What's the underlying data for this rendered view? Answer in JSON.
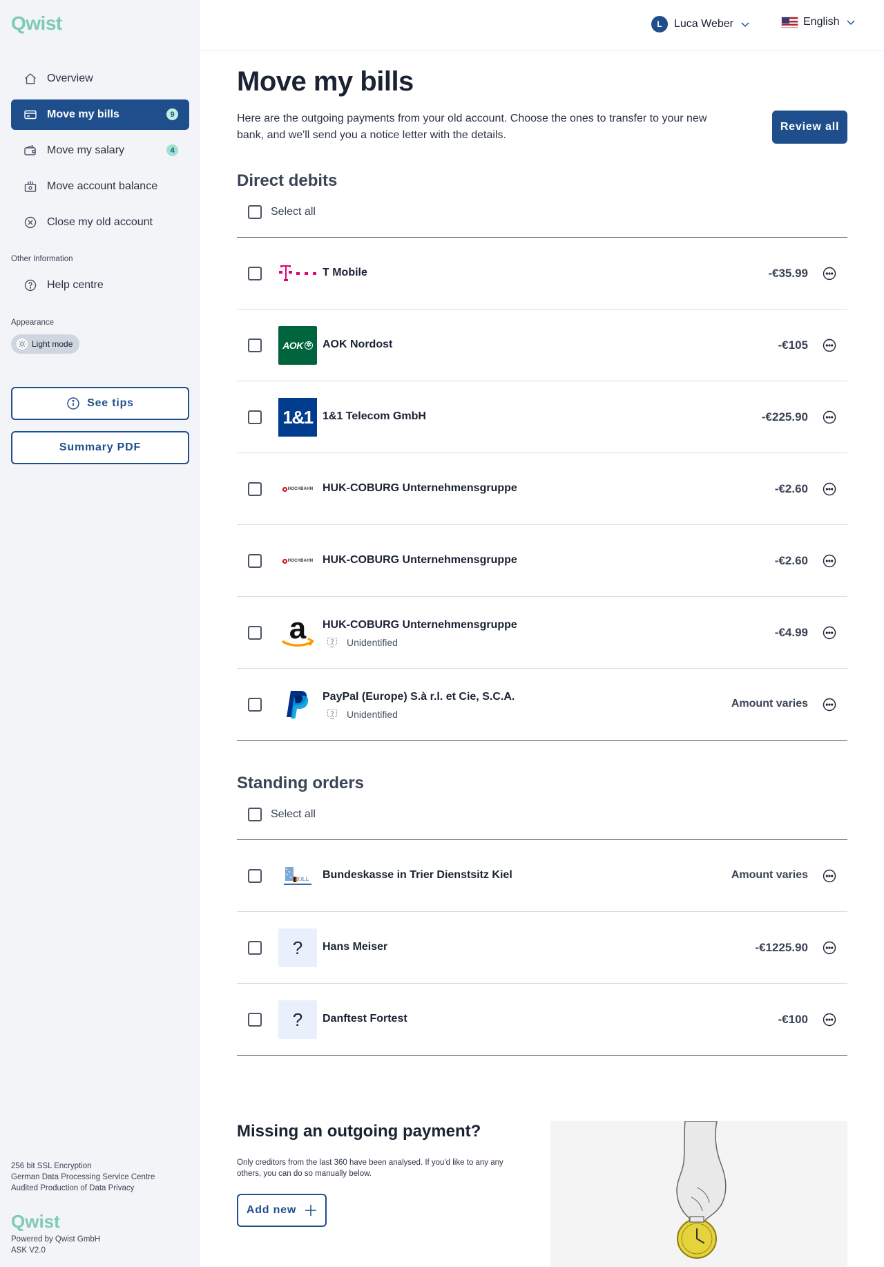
{
  "brand": {
    "name": "Qwist",
    "accent": "#7ecbb2",
    "primary": "#1f4e8c"
  },
  "sidebar": {
    "items": [
      {
        "label": "Overview",
        "icon": "home-icon"
      },
      {
        "label": "Move my bills",
        "icon": "card-icon",
        "badge": "9",
        "active": true
      },
      {
        "label": "Move my salary",
        "icon": "wallet-icon",
        "badge": "4"
      },
      {
        "label": "Move account balance",
        "icon": "bank-icon"
      },
      {
        "label": "Close my old account",
        "icon": "close-circle-icon"
      }
    ],
    "other_label": "Other Information",
    "help_label": "Help centre",
    "appearance_label": "Appearance",
    "mode_label": "Light mode",
    "tips_label": "See tips",
    "pdf_label": "Summary PDF",
    "security_lines": [
      "256 bit SSL Encryption",
      "German Data Processing Service Centre",
      "Audited Production of Data Privacy"
    ],
    "footer_brand": "Qwist",
    "powered": "Powered by Qwist GmbH",
    "version": "ASK V2.0"
  },
  "header": {
    "user_initial": "L",
    "user_name": "Luca Weber",
    "language": "English"
  },
  "main": {
    "title": "Move my bills",
    "intro": "Here are the outgoing payments from your old account. Choose the ones to transfer to your new bank, and we'll send you a notice letter with the details.",
    "review_label": "Review all",
    "select_all": "Select all",
    "direct_debits": {
      "title": "Direct debits",
      "rows": [
        {
          "name": "T Mobile",
          "amount": "-€35.99",
          "logo": "tmobile"
        },
        {
          "name": "AOK Nordost",
          "amount": "-€105",
          "logo": "aok"
        },
        {
          "name": "1&1 Telecom GmbH",
          "amount": "-€225.90",
          "logo": "oneandone"
        },
        {
          "name": "HUK-COBURG Unternehmensgruppe",
          "amount": "-€2.60",
          "logo": "hochbahn"
        },
        {
          "name": "HUK-COBURG Unternehmensgruppe",
          "amount": "-€2.60",
          "logo": "hochbahn"
        },
        {
          "name": "HUK-COBURG Unternehmensgruppe",
          "amount": "-€4.99",
          "logo": "amazon",
          "status": "Unidentified"
        },
        {
          "name": "PayPal (Europe) S.à r.l. et Cie, S.C.A.",
          "amount": "Amount varies",
          "logo": "paypal",
          "status": "Unidentified"
        }
      ]
    },
    "standing_orders": {
      "title": "Standing orders",
      "rows": [
        {
          "name": "Bundeskasse in Trier Dienstsitz Kiel",
          "amount": "Amount varies",
          "logo": "zoll"
        },
        {
          "name": "Hans Meiser",
          "amount": "-€1225.90",
          "logo": "unknown"
        },
        {
          "name": "Danftest Fortest",
          "amount": "-€100",
          "logo": "unknown"
        }
      ]
    },
    "logo_text": {
      "aok": "AOK",
      "oneandone": "1&1",
      "hochbahn": "HOCHBAHN",
      "zoll": "ZOLL",
      "unknown": "?"
    },
    "missing": {
      "title": "Missing an outgoing payment?",
      "text": "Only creditors from the last 360 have been analysed. If you'd like to any any others, you can do so manually below.",
      "add_label": "Add new"
    }
  }
}
